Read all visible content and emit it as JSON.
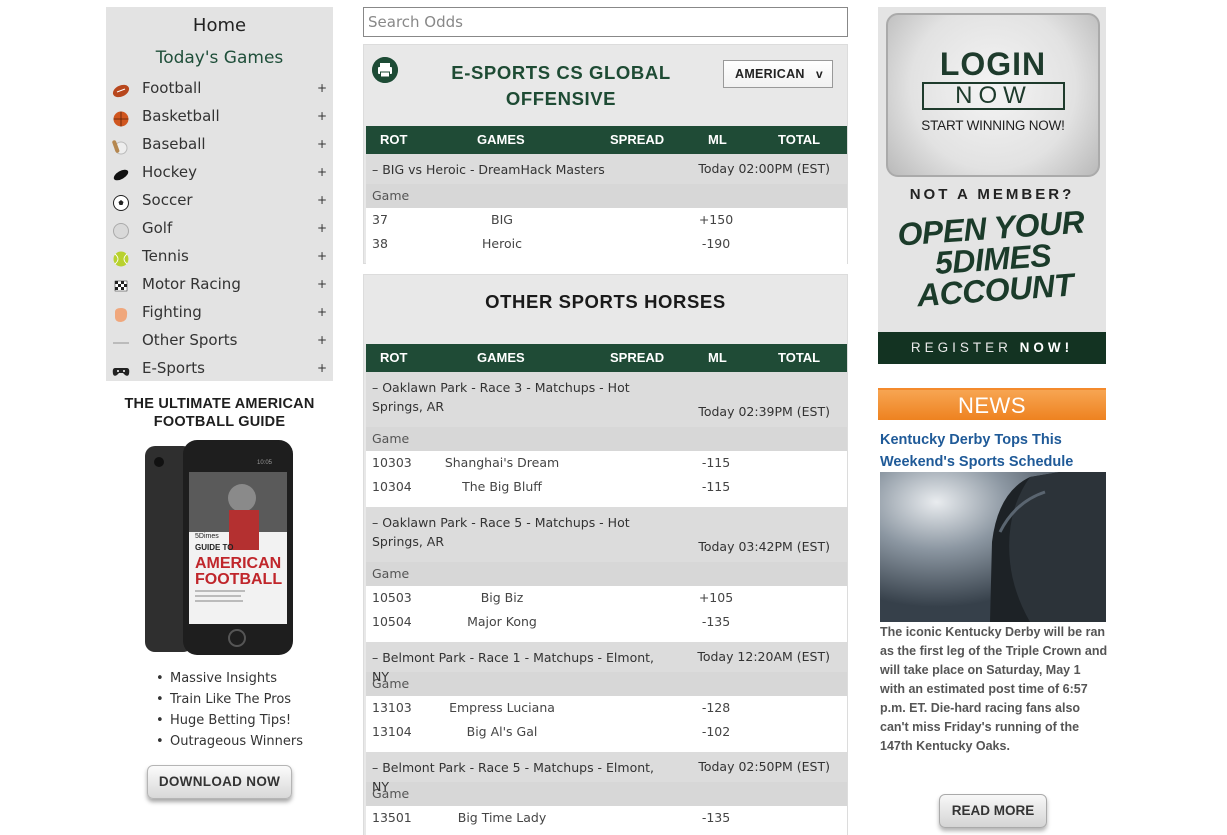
{
  "sidebar": {
    "home": "Home",
    "todays_games": "Today's Games",
    "sports": [
      {
        "label": "Football",
        "icon": "football-icon"
      },
      {
        "label": "Basketball",
        "icon": "basketball-icon"
      },
      {
        "label": "Baseball",
        "icon": "baseball-icon"
      },
      {
        "label": "Hockey",
        "icon": "hockey-puck-icon"
      },
      {
        "label": "Soccer",
        "icon": "soccer-ball-icon"
      },
      {
        "label": "Golf",
        "icon": "golf-ball-icon"
      },
      {
        "label": "Tennis",
        "icon": "tennis-ball-icon"
      },
      {
        "label": "Motor Racing",
        "icon": "checkered-flag-icon"
      },
      {
        "label": "Fighting",
        "icon": "boxing-glove-icon"
      },
      {
        "label": "Other Sports",
        "icon": "other-sports-icon"
      },
      {
        "label": "E-Sports",
        "icon": "gamepad-icon"
      }
    ],
    "expand_symbol": "+"
  },
  "promo": {
    "title": "THE ULTIMATE AMERICAN FOOTBALL GUIDE",
    "book_brand": "5Dimes",
    "book_sub": "GUIDE TO",
    "book_title_1": "AMERICAN",
    "book_title_2": "FOOTBALL",
    "phone_time": "10:05",
    "bullets": [
      "Massive Insights",
      "Train Like The Pros",
      "Huge Betting Tips!",
      "Outrageous Winners"
    ],
    "download_label": "DOWNLOAD NOW"
  },
  "search": {
    "placeholder": "Search Odds",
    "value": ""
  },
  "columns": {
    "rot": "ROT",
    "games": "GAMES",
    "spread": "SPREAD",
    "ml": "ML",
    "total": "TOTAL"
  },
  "game_label": "Game",
  "panel1": {
    "title": "E-SPORTS CS GLOBAL OFFENSIVE",
    "odds_format": "AMERICAN",
    "select_arrow": "v",
    "events": [
      {
        "name": "– BIG vs Heroic - DreamHack Masters",
        "time": "Today 02:00PM (EST)",
        "rows": [
          {
            "rot": "37",
            "team": "BIG",
            "ml": "+150"
          },
          {
            "rot": "38",
            "team": "Heroic",
            "ml": "-190"
          }
        ]
      }
    ]
  },
  "panel2": {
    "title": "OTHER SPORTS HORSES",
    "events": [
      {
        "name": "– Oaklawn Park - Race 3 - Matchups - Hot Springs, AR",
        "time": "Today 02:39PM (EST)",
        "rows": [
          {
            "rot": "10303",
            "team": "Shanghai's Dream",
            "ml": "-115"
          },
          {
            "rot": "10304",
            "team": "The Big Bluff",
            "ml": "-115"
          }
        ]
      },
      {
        "name": "– Oaklawn Park - Race 5 - Matchups - Hot Springs, AR",
        "time": "Today 03:42PM (EST)",
        "rows": [
          {
            "rot": "10503",
            "team": "Big Biz",
            "ml": "+105"
          },
          {
            "rot": "10504",
            "team": "Major Kong",
            "ml": "-135"
          }
        ]
      },
      {
        "name": "– Belmont Park - Race 1 - Matchups - Elmont, NY",
        "time": "Today 12:20AM (EST)",
        "rows": [
          {
            "rot": "13103",
            "team": "Empress Luciana",
            "ml": "-128"
          },
          {
            "rot": "13104",
            "team": "Big Al's Gal",
            "ml": "-102"
          }
        ]
      },
      {
        "name": "– Belmont Park - Race 5 - Matchups - Elmont, NY",
        "time": "Today 02:50PM (EST)",
        "rows": [
          {
            "rot": "13501",
            "team": "Big Time Lady",
            "ml": "-135"
          }
        ]
      }
    ]
  },
  "login_ad": {
    "login": "LOGIN",
    "now": "NOW",
    "start": "START WINNING NOW!",
    "not_member": "NOT A MEMBER?",
    "open_line1": "OPEN YOUR",
    "open_line2": "5DIMES",
    "open_line3": "ACCOUNT",
    "register": "REGISTER",
    "register_now": "NOW!"
  },
  "news": {
    "header": "NEWS",
    "title": "Kentucky Derby Tops This Weekend's Sports Schedule",
    "body": "The iconic Kentucky Derby will be ran as the first leg of the Triple Crown and will take place on Saturday, May 1 with an estimated post time of 6:57 p.m. ET. Die-hard racing fans also can't miss Friday's running of the 147th Kentucky Oaks.",
    "read_more": "READ MORE"
  },
  "colors": {
    "brand_green": "#1f4b36",
    "news_orange": "#ee8220",
    "link_blue": "#1f5a98",
    "sidebar_bg": "#e3e3e3"
  }
}
